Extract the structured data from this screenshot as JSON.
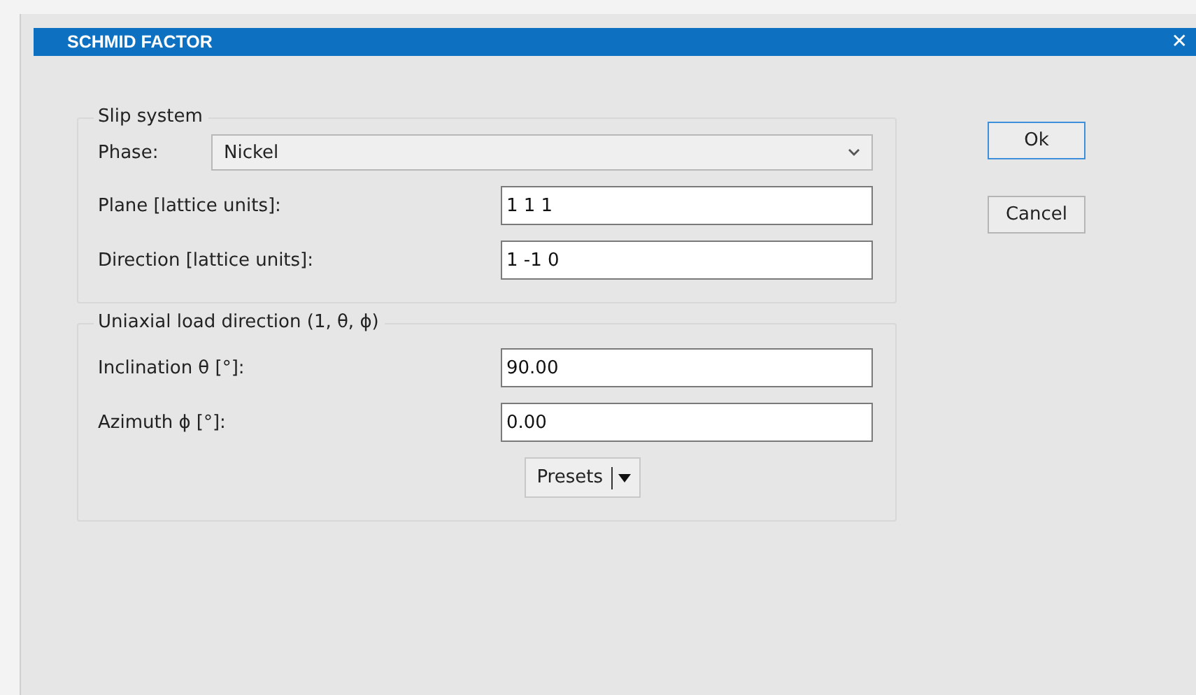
{
  "window": {
    "title": "SCHMID FACTOR",
    "close": "✕"
  },
  "slip_system": {
    "title": "Slip system",
    "phase": {
      "label": "Phase:",
      "value": "Nickel"
    },
    "fields": [
      {
        "label": "Plane [lattice units]:",
        "value": "1 1 1"
      },
      {
        "label": "Direction [lattice units]:",
        "value": "1 -1 0"
      }
    ]
  },
  "load_direction": {
    "title": "Uniaxial load direction (1, θ, ϕ)",
    "fields": [
      {
        "label": "Inclination θ [°]:",
        "value": "90.00"
      },
      {
        "label": "Azimuth ϕ [°]:",
        "value": "0.00"
      }
    ],
    "presets": "Presets"
  },
  "buttons": [
    {
      "label": "Ok",
      "default": true
    },
    {
      "label": "Cancel",
      "default": false
    }
  ]
}
